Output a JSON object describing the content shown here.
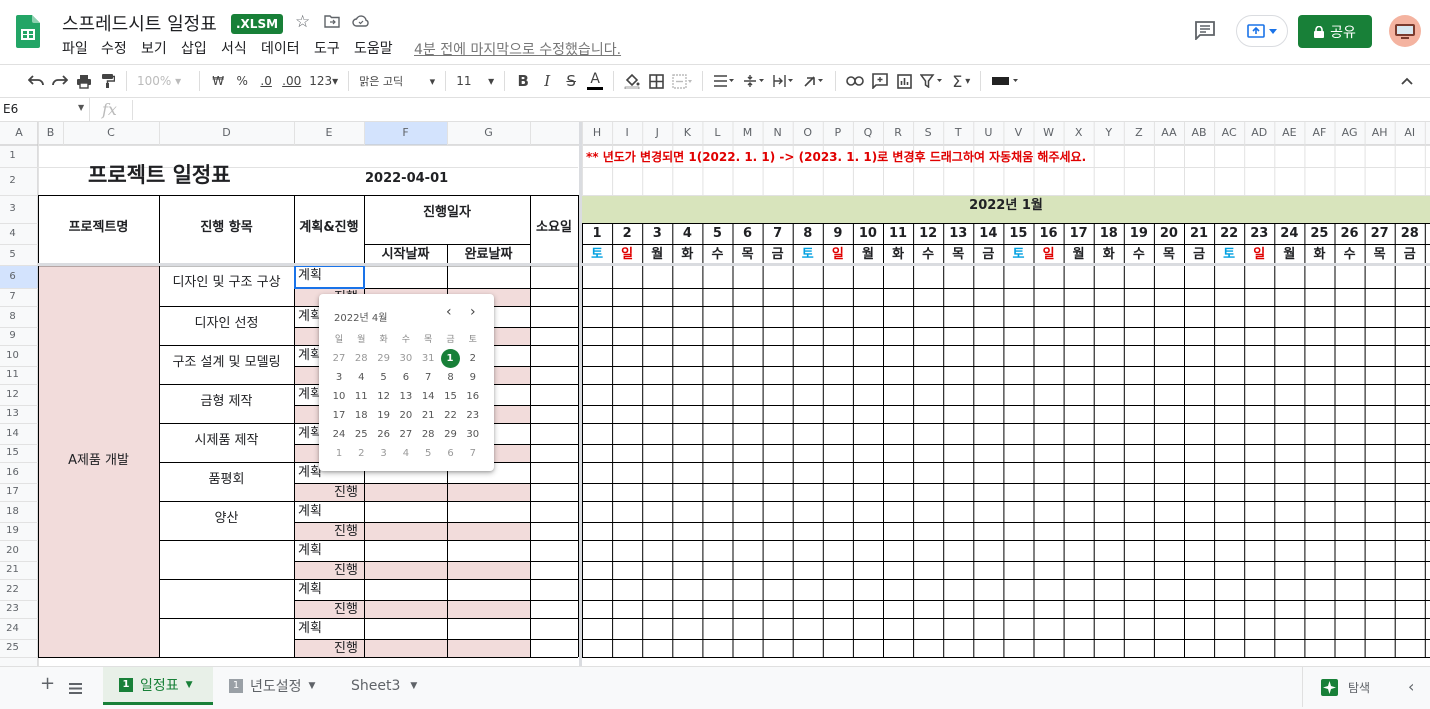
{
  "app": {
    "doc_title": "스프레드시트 일정표",
    "file_badge": ".XLSM",
    "last_edit": "4분 전에 마지막으로 수정했습니다.",
    "share_label": "공유",
    "menus": [
      "파일",
      "수정",
      "보기",
      "삽입",
      "서식",
      "데이터",
      "도구",
      "도움말"
    ]
  },
  "toolbar": {
    "zoom": "100%",
    "currency": "₩",
    "percent": "%",
    "dec_less": ".0",
    "dec_more": ".00",
    "format_more": "123",
    "font": "맑은 고딕",
    "font_size": "11"
  },
  "formula_bar": {
    "name_box": "E6",
    "fx": "fx",
    "value": ""
  },
  "grid": {
    "col_headers_left": [
      "A",
      "B",
      "C",
      "D",
      "E",
      "F",
      "G"
    ],
    "col_headers_right": [
      "H",
      "I",
      "J",
      "K",
      "L",
      "M",
      "N",
      "O",
      "P",
      "Q",
      "R",
      "S",
      "T",
      "U",
      "V",
      "W",
      "X",
      "Y",
      "Z",
      "AA",
      "AB",
      "AC",
      "AD",
      "AE",
      "AF",
      "AG",
      "AH",
      "AI"
    ],
    "row_numbers": [
      "1",
      "2",
      "3",
      "4",
      "5",
      "6",
      "7",
      "8",
      "9",
      "10",
      "11",
      "12",
      "13",
      "14",
      "15",
      "16",
      "17",
      "18",
      "19",
      "20",
      "21",
      "22",
      "23",
      "24",
      "25"
    ],
    "notice": "** 년도가 변경되면 1(2022. 1. 1) -> (2023. 1. 1)로 변경후 드래그하여 자동채움 해주세요.",
    "title": "프로젝트 일정표",
    "date": "2022-04-01",
    "headers": {
      "project": "프로젝트명",
      "item": "진행 항목",
      "plan": "계획&진행",
      "progress_date": "진행일자",
      "start": "시작날짜",
      "end": "완료날짜",
      "duration": "소요일"
    },
    "month_label": "2022년 1월",
    "days": [
      "1",
      "2",
      "3",
      "4",
      "5",
      "6",
      "7",
      "8",
      "9",
      "10",
      "11",
      "12",
      "13",
      "14",
      "15",
      "16",
      "17",
      "18",
      "19",
      "20",
      "21",
      "22",
      "23",
      "24",
      "25",
      "26",
      "27",
      "28"
    ],
    "weekdays": [
      "토",
      "일",
      "월",
      "화",
      "수",
      "목",
      "금",
      "토",
      "일",
      "월",
      "화",
      "수",
      "목",
      "금",
      "토",
      "일",
      "월",
      "화",
      "수",
      "목",
      "금",
      "토",
      "일",
      "월",
      "화",
      "수",
      "목",
      "금"
    ],
    "project_name": "A제품 개발",
    "items": [
      "디자인 및 구조 구상",
      "디자인 선정",
      "구조 설계 및 모델링",
      "금형 제작",
      "시제품 제작",
      "품평회",
      "양산",
      "",
      "",
      ""
    ],
    "plan_label": "계획",
    "progress_label": "진행"
  },
  "datepicker": {
    "month_label": "2022년 4월",
    "dow": [
      "일",
      "월",
      "화",
      "수",
      "목",
      "금",
      "토"
    ],
    "weeks": [
      [
        "27",
        "28",
        "29",
        "30",
        "31",
        "1",
        "2"
      ],
      [
        "3",
        "4",
        "5",
        "6",
        "7",
        "8",
        "9"
      ],
      [
        "10",
        "11",
        "12",
        "13",
        "14",
        "15",
        "16"
      ],
      [
        "17",
        "18",
        "19",
        "20",
        "21",
        "22",
        "23"
      ],
      [
        "24",
        "25",
        "26",
        "27",
        "28",
        "29",
        "30"
      ],
      [
        "1",
        "2",
        "3",
        "4",
        "5",
        "6",
        "7"
      ]
    ],
    "selected": "1"
  },
  "sheets": {
    "tabs": [
      "일정표",
      "년도설정",
      "Sheet3"
    ],
    "active": "일정표",
    "explore_label": "탐색"
  },
  "colors": {
    "brand_green": "#188038",
    "pink_fill": "#f2dcdb",
    "month_header_fill": "#d8e4bc",
    "notice_red": "#e00000",
    "sat_blue": "#00a0e0",
    "sun_red": "#e00000",
    "selection_blue": "#1a73e8"
  }
}
